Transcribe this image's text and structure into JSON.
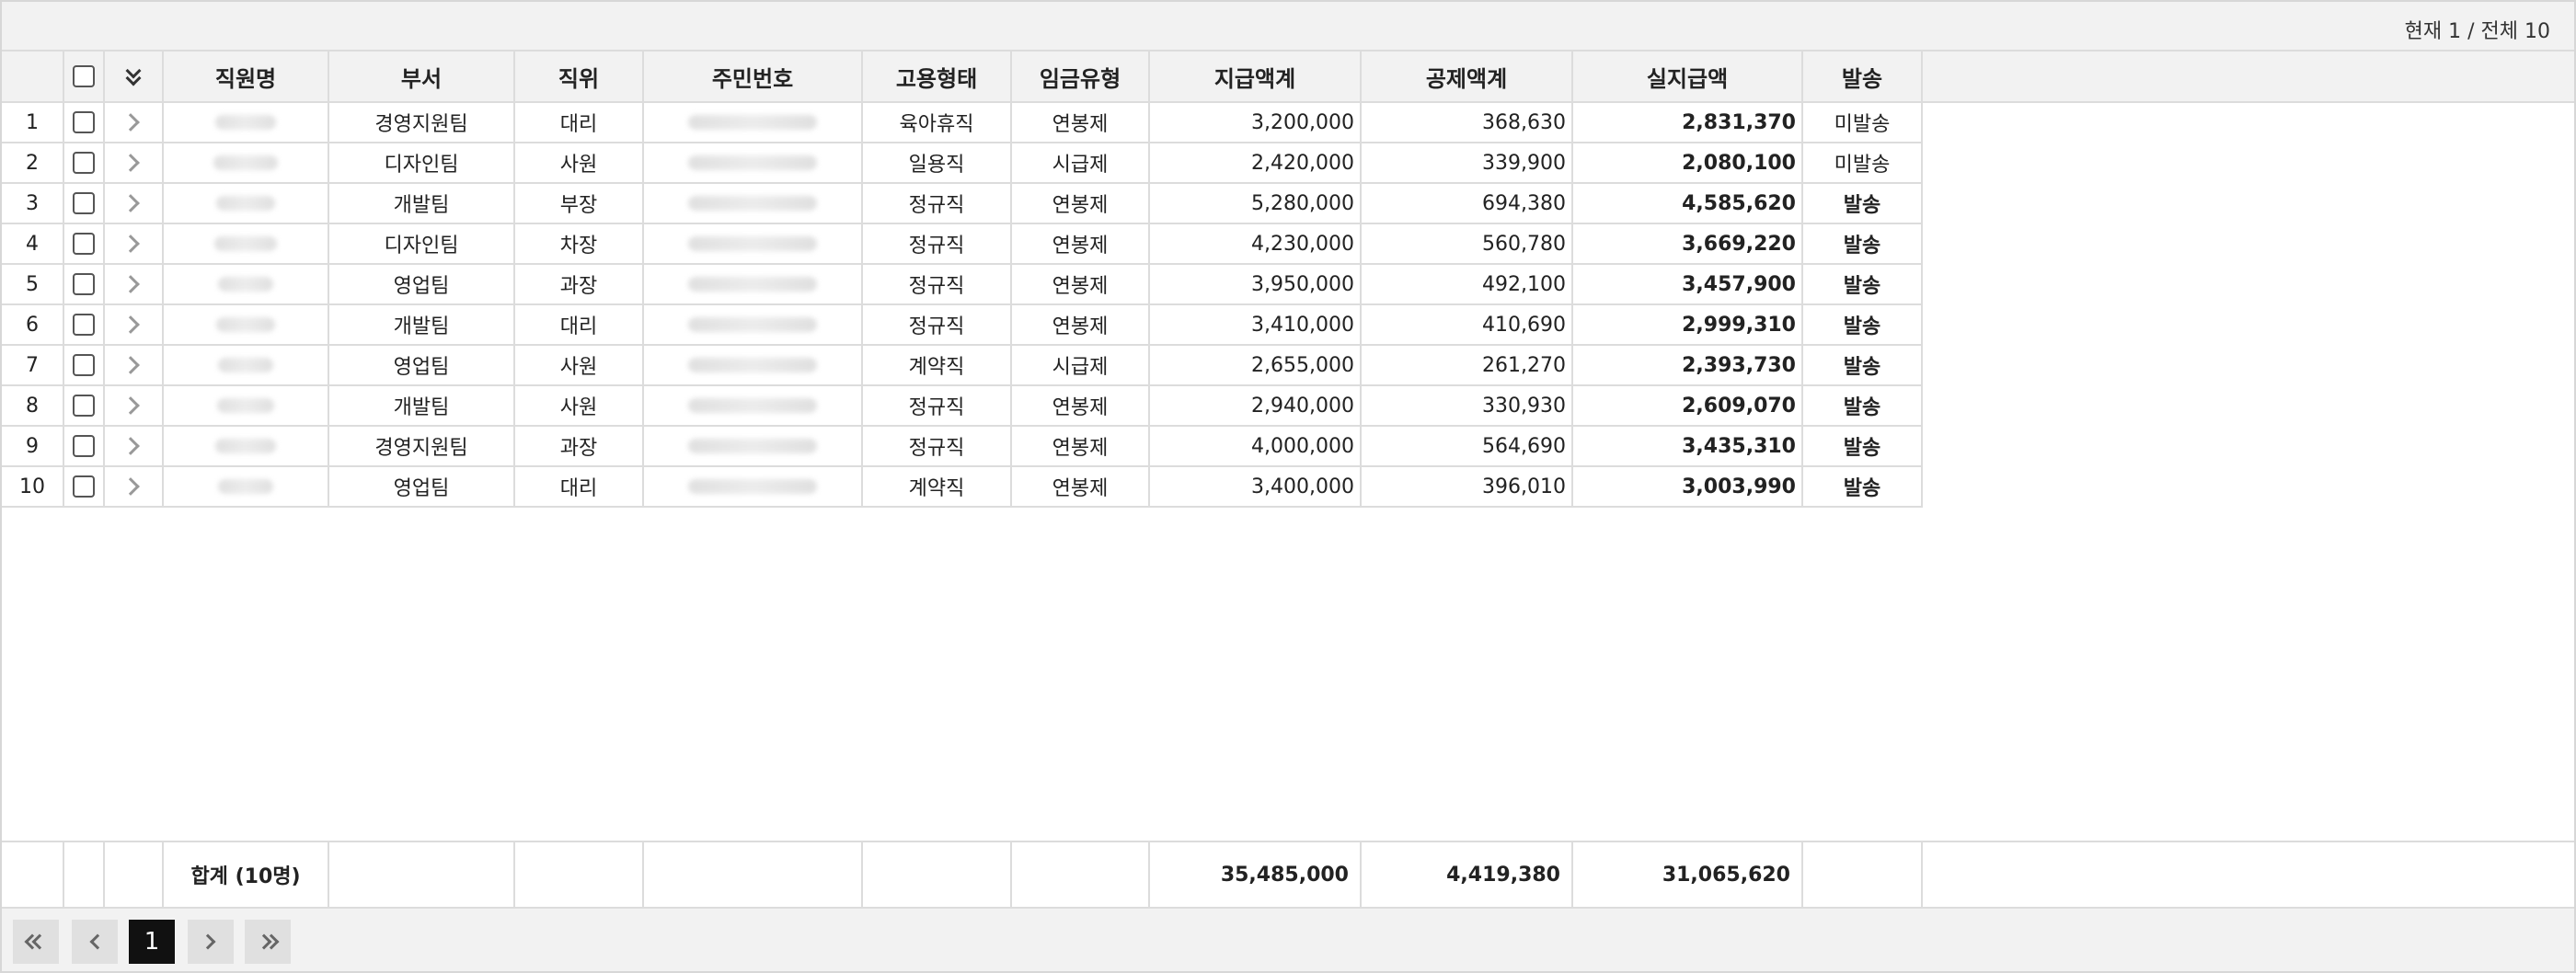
{
  "page_info": "현재 1 / 전체 10",
  "columns": {
    "name": "직원명",
    "dept": "부서",
    "position": "직위",
    "rrn": "주민번호",
    "employment": "고용형태",
    "wage_type": "임금유형",
    "gross": "지급액계",
    "deduction": "공제액계",
    "net": "실지급액",
    "sent": "발송"
  },
  "rows": [
    {
      "no": "1",
      "dept": "경영지원팀",
      "position": "대리",
      "employment": "육아휴직",
      "wage_type": "연봉제",
      "gross": "3,200,000",
      "deduction": "368,630",
      "net": "2,831,370",
      "sent": "미발송",
      "sent_state": "unsent"
    },
    {
      "no": "2",
      "dept": "디자인팀",
      "position": "사원",
      "employment": "일용직",
      "wage_type": "시급제",
      "gross": "2,420,000",
      "deduction": "339,900",
      "net": "2,080,100",
      "sent": "미발송",
      "sent_state": "unsent"
    },
    {
      "no": "3",
      "dept": "개발팀",
      "position": "부장",
      "employment": "정규직",
      "wage_type": "연봉제",
      "gross": "5,280,000",
      "deduction": "694,380",
      "net": "4,585,620",
      "sent": "발송",
      "sent_state": "sent"
    },
    {
      "no": "4",
      "dept": "디자인팀",
      "position": "차장",
      "employment": "정규직",
      "wage_type": "연봉제",
      "gross": "4,230,000",
      "deduction": "560,780",
      "net": "3,669,220",
      "sent": "발송",
      "sent_state": "sent"
    },
    {
      "no": "5",
      "dept": "영업팀",
      "position": "과장",
      "employment": "정규직",
      "wage_type": "연봉제",
      "gross": "3,950,000",
      "deduction": "492,100",
      "net": "3,457,900",
      "sent": "발송",
      "sent_state": "sent"
    },
    {
      "no": "6",
      "dept": "개발팀",
      "position": "대리",
      "employment": "정규직",
      "wage_type": "연봉제",
      "gross": "3,410,000",
      "deduction": "410,690",
      "net": "2,999,310",
      "sent": "발송",
      "sent_state": "sent"
    },
    {
      "no": "7",
      "dept": "영업팀",
      "position": "사원",
      "employment": "계약직",
      "wage_type": "시급제",
      "gross": "2,655,000",
      "deduction": "261,270",
      "net": "2,393,730",
      "sent": "발송",
      "sent_state": "sent"
    },
    {
      "no": "8",
      "dept": "개발팀",
      "position": "사원",
      "employment": "정규직",
      "wage_type": "연봉제",
      "gross": "2,940,000",
      "deduction": "330,930",
      "net": "2,609,070",
      "sent": "발송",
      "sent_state": "sent"
    },
    {
      "no": "9",
      "dept": "경영지원팀",
      "position": "과장",
      "employment": "정규직",
      "wage_type": "연봉제",
      "gross": "4,000,000",
      "deduction": "564,690",
      "net": "3,435,310",
      "sent": "발송",
      "sent_state": "sent"
    },
    {
      "no": "10",
      "dept": "영업팀",
      "position": "대리",
      "employment": "계약직",
      "wage_type": "연봉제",
      "gross": "3,400,000",
      "deduction": "396,010",
      "net": "3,003,990",
      "sent": "발송",
      "sent_state": "sent"
    }
  ],
  "summary": {
    "label": "합계 (10명)",
    "gross": "35,485,000",
    "deduction": "4,419,380",
    "net": "31,065,620"
  },
  "pager": {
    "current_page": "1"
  },
  "colors": {
    "sent": "#1aa5a0",
    "unsent": "#c0c0c0",
    "header_bg": "#f2f2f2",
    "active_page": "#111111"
  },
  "icons": {
    "select_all": "checkbox-icon",
    "expand_all": "double-chevron-down-icon",
    "row_expand": "chevron-right-icon",
    "first": "double-chevron-left-icon",
    "prev": "chevron-left-icon",
    "next": "chevron-right-icon",
    "last": "double-chevron-right-icon"
  }
}
